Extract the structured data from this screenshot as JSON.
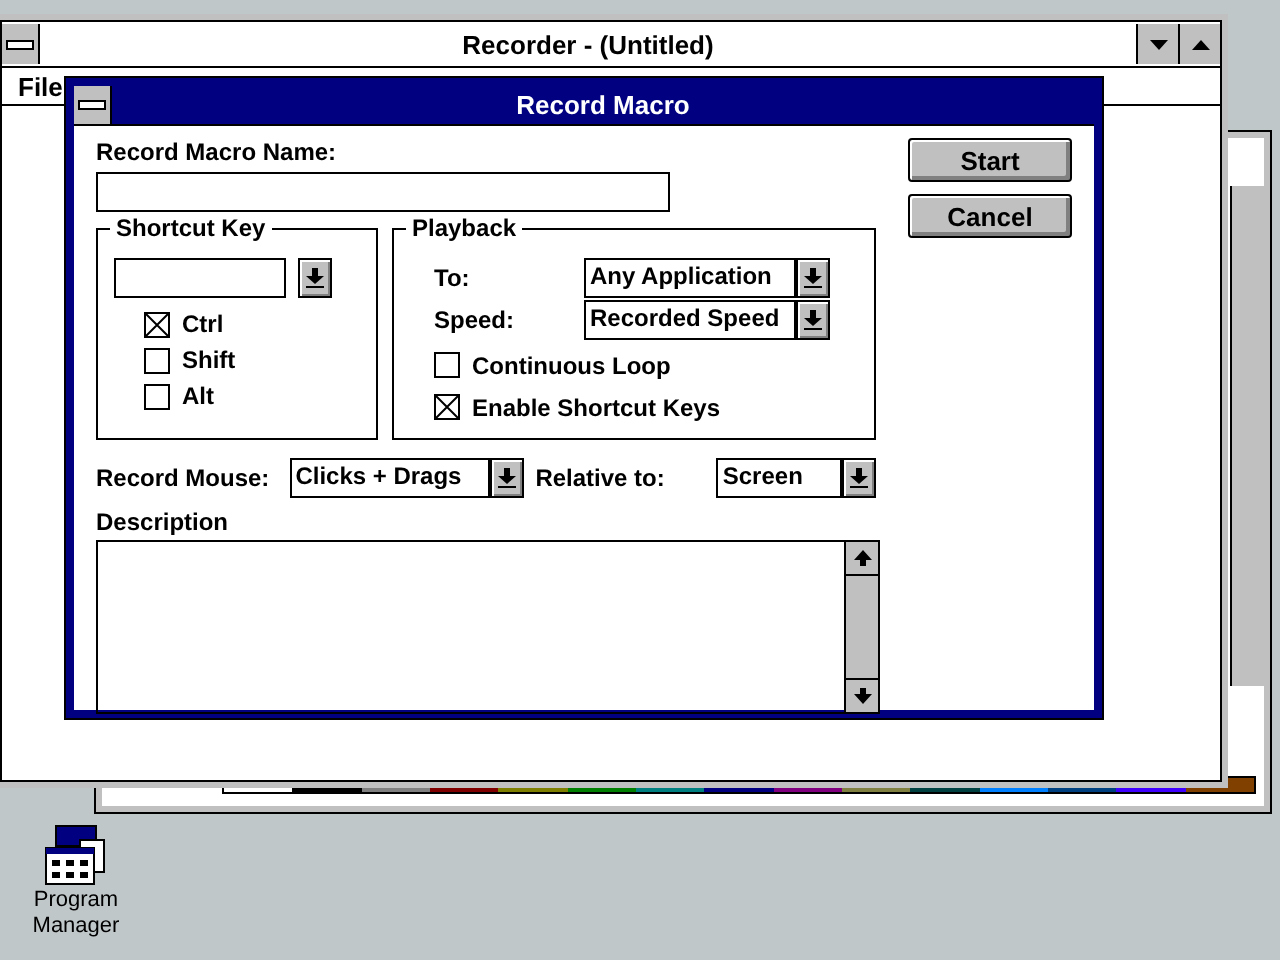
{
  "recorder": {
    "title": "Recorder - (Untitled)",
    "menu": [
      "File"
    ]
  },
  "dialog": {
    "title": "Record Macro",
    "name_label": "Record Macro Name:",
    "shortcut_key": {
      "label": "Shortcut Key",
      "modifiers": [
        {
          "label": "Ctrl",
          "checked": true
        },
        {
          "label": "Shift",
          "checked": false
        },
        {
          "label": "Alt",
          "checked": false
        }
      ]
    },
    "playback": {
      "label": "Playback",
      "to": {
        "label": "To:",
        "value": "Any Application"
      },
      "speed": {
        "label": "Speed:",
        "value": "Recorded Speed"
      },
      "options": [
        {
          "label": "Continuous Loop",
          "checked": false
        },
        {
          "label": "Enable Shortcut Keys",
          "checked": true
        }
      ]
    },
    "record_mouse": {
      "label": "Record Mouse:",
      "value": "Clicks + Drags"
    },
    "relative_to": {
      "label": "Relative to:",
      "value": "Screen"
    },
    "description": {
      "label": "Description"
    },
    "buttons": [
      "Start",
      "Cancel"
    ]
  },
  "desktop_icons": [
    {
      "label": "Program Manager"
    }
  ]
}
